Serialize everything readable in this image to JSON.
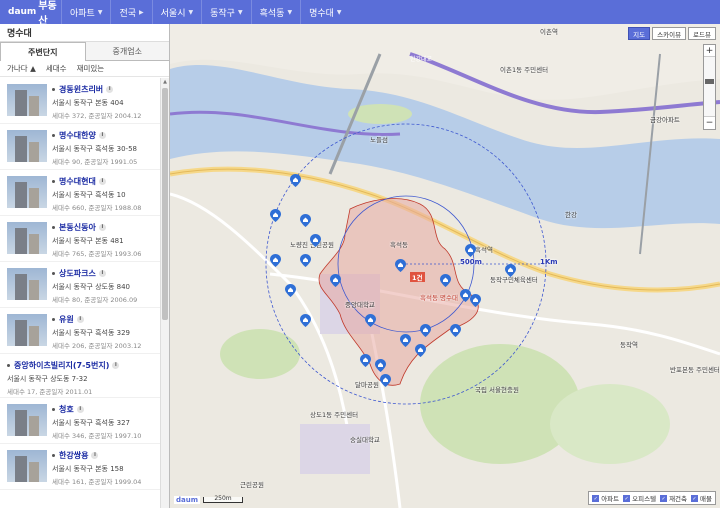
{
  "header": {
    "logo_text": "daum",
    "service_name": "부동산",
    "breadcrumbs": [
      {
        "label": "아파트"
      },
      {
        "label": "전국"
      },
      {
        "label": "서울시"
      },
      {
        "label": "동작구"
      },
      {
        "label": "흑석동"
      },
      {
        "label": "명수대"
      }
    ],
    "colors": {
      "bar": "#5a6ed8"
    }
  },
  "sidebar": {
    "title": "명수대",
    "tabs": [
      {
        "label": "주변단지",
        "active": true
      },
      {
        "label": "중개업소",
        "active": false
      }
    ],
    "sort_options": [
      "가나다 ▲",
      "세대수",
      "재미있는"
    ],
    "items": [
      {
        "name": "경동윈츠리버",
        "addr": "서울시 동작구 본동 404",
        "info": "세대수 372, 준공일자 2004.12",
        "has_image": true
      },
      {
        "name": "명수대한양",
        "addr": "서울시 동작구 흑석동 30-58",
        "info": "세대수 90, 준공일자 1991.05",
        "has_image": true
      },
      {
        "name": "명수대현대",
        "addr": "서울시 동작구 흑석동 10",
        "info": "세대수 660, 준공일자 1988.08",
        "has_image": true
      },
      {
        "name": "본동신동아",
        "addr": "서울시 동작구 본동 481",
        "info": "세대수 765, 준공일자 1993.06",
        "has_image": true
      },
      {
        "name": "상도파크스",
        "addr": "서울시 동작구 상도동 840",
        "info": "세대수 80, 준공일자 2006.09",
        "has_image": true
      },
      {
        "name": "유원",
        "addr": "서울시 동작구 흑석동 329",
        "info": "세대수 206, 준공일자 2003.12",
        "has_image": true
      },
      {
        "name": "중앙하이츠빌리지(7-5번지)",
        "addr": "서울시 동작구 상도동 7-32",
        "info": "세대수 17, 준공일자 2011.01",
        "has_image": false
      },
      {
        "name": "청호",
        "addr": "서울시 동작구 흑석동 327",
        "info": "세대수 346, 준공일자 1997.10",
        "has_image": true
      },
      {
        "name": "한강쌍용",
        "addr": "서울시 동작구 본동 158",
        "info": "세대수 161, 준공일자 1999.04",
        "has_image": true
      }
    ]
  },
  "map": {
    "controls": [
      {
        "label": "지도",
        "active": true
      },
      {
        "label": "스카이뷰",
        "active": false
      },
      {
        "label": "로드뷰",
        "active": false
      }
    ],
    "labels": [
      {
        "text": "이촌역"
      },
      {
        "text": "이촌1동 주민센터"
      },
      {
        "text": "한강대교"
      },
      {
        "text": "노들섬"
      },
      {
        "text": "한강"
      },
      {
        "text": "흑석역"
      },
      {
        "text": "흑석동"
      },
      {
        "text": "중앙대학교"
      },
      {
        "text": "국립 서울현충원"
      },
      {
        "text": "동작역"
      },
      {
        "text": "숭실대학교"
      },
      {
        "text": "노량진 근린공원"
      },
      {
        "text": "상도1동 주민센터"
      },
      {
        "text": "근린공원"
      },
      {
        "text": "금강아파트"
      },
      {
        "text": "동작구민체육센터"
      },
      {
        "text": "달마공원"
      },
      {
        "text": "반포본동 주민센터"
      }
    ],
    "circle_labels": {
      "inner": "500m",
      "outer": "1Km"
    },
    "center_tag": "1건",
    "center_label": "흑석동 명수대",
    "scale_label": "250m",
    "legend": [
      {
        "label": "아파트",
        "checked": true
      },
      {
        "label": "오피스텔",
        "checked": true
      },
      {
        "label": "재건축",
        "checked": true
      },
      {
        "label": "매물",
        "checked": true
      }
    ],
    "colors": {
      "river": "#b7cde8",
      "boundary": "#e8a9a3",
      "circle": "#3e58d0",
      "pin": "#2f6fd6",
      "park": "#cfe2b6"
    }
  }
}
